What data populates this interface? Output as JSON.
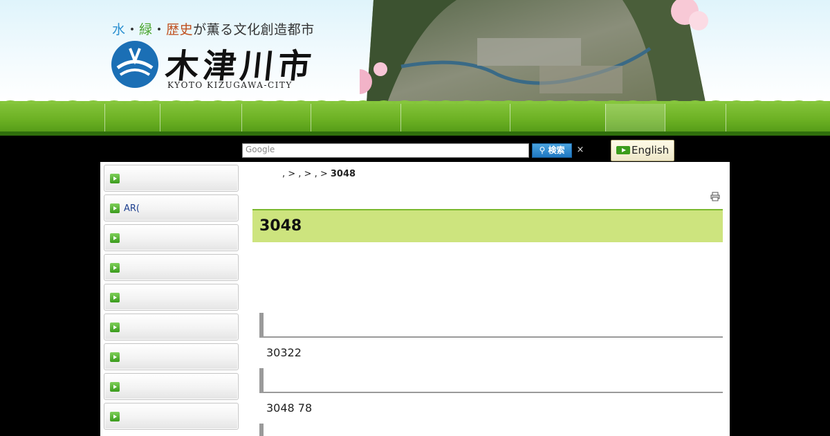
{
  "header": {
    "tagline_parts": [
      "水",
      "・",
      "緑",
      "・",
      "歴史",
      "が薫る文化創造都市"
    ],
    "city_name": "木津川市",
    "city_name_en": "KYOTO KIZUGAWA-CITY"
  },
  "search": {
    "placeholder": "Google",
    "button_label": "検索",
    "clear_label": "×"
  },
  "language": {
    "english_label": "English"
  },
  "sidebar": {
    "items": [
      {
        "label": ""
      },
      {
        "label": "AR("
      },
      {
        "label": ""
      },
      {
        "label": ""
      },
      {
        "label": ""
      },
      {
        "label": ""
      },
      {
        "label": ""
      },
      {
        "label": ""
      },
      {
        "label": ""
      }
    ]
  },
  "breadcrumb": {
    "text": ", > , > , > ",
    "current": "3048"
  },
  "main": {
    "title": "3048",
    "sections": [
      {
        "heading": "",
        "text": "30322"
      },
      {
        "heading": "",
        "text": "3048  78"
      }
    ]
  },
  "colors": {
    "nav_green": "#6bb023",
    "title_bg": "#cde47e",
    "search_button": "#1f78c2"
  }
}
